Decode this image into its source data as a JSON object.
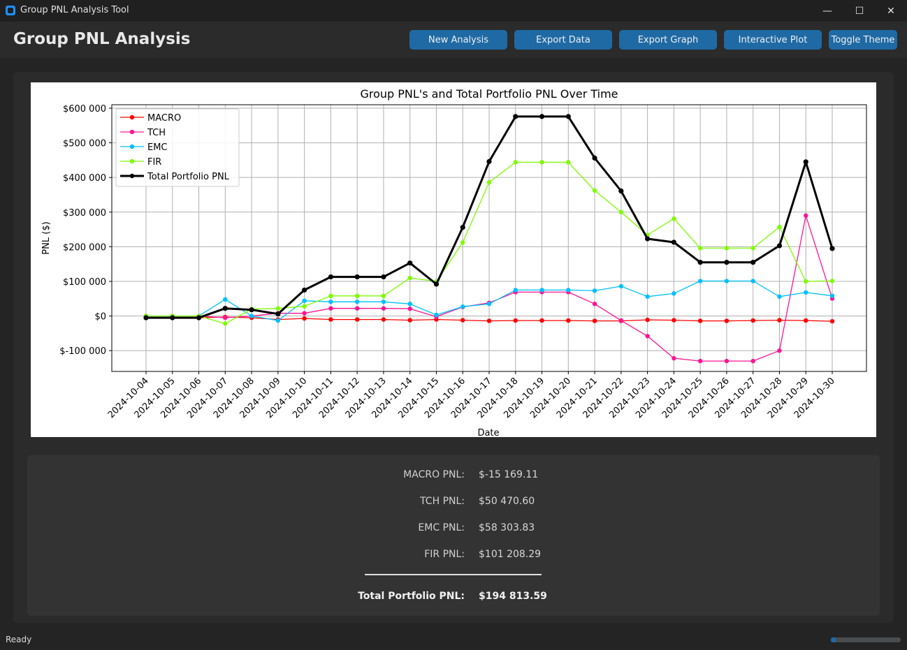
{
  "window": {
    "title": "Group PNL Analysis Tool",
    "minimize": "—",
    "maximize": "☐",
    "close": "✕"
  },
  "header": {
    "title": "Group PNL Analysis"
  },
  "toolbar": {
    "new_analysis": "New Analysis",
    "export_data": "Export Data",
    "export_graph": "Export Graph",
    "interactive_plot": "Interactive Plot",
    "toggle_theme": "Toggle Theme"
  },
  "summary": {
    "rows": [
      {
        "label": "MACRO PNL:",
        "value": "$-15 169.11"
      },
      {
        "label": "TCH PNL:",
        "value": "$50 470.60"
      },
      {
        "label": "EMC PNL:",
        "value": "$58 303.83"
      },
      {
        "label": "FIR PNL:",
        "value": "$101 208.29"
      }
    ],
    "total_label": "Total Portfolio PNL:",
    "total_value": "$194 813.59"
  },
  "status": {
    "text": "Ready",
    "progress": 0.07
  },
  "colors": {
    "accent": "#1f6aa5",
    "macro": "#ff0000",
    "tch": "#ff1493",
    "emc": "#00bfff",
    "fir": "#7cfc00",
    "total": "#000000"
  },
  "chart_data": {
    "type": "line",
    "title": "Group PNL's and Total Portfolio PNL Over Time",
    "xlabel": "Date",
    "ylabel": "PNL ($)",
    "ylim": [
      -160000,
      610000
    ],
    "yticks": [
      -100000,
      0,
      100000,
      200000,
      300000,
      400000,
      500000,
      600000
    ],
    "ytick_labels": [
      "$-100 000",
      "$0",
      "$100 000",
      "$200 000",
      "$300 000",
      "$400 000",
      "$500 000",
      "$600 000"
    ],
    "grid": true,
    "legend": "top-left",
    "x": [
      "2024-10-04",
      "2024-10-05",
      "2024-10-06",
      "2024-10-07",
      "2024-10-08",
      "2024-10-09",
      "2024-10-10",
      "2024-10-11",
      "2024-10-12",
      "2024-10-13",
      "2024-10-14",
      "2024-10-15",
      "2024-10-16",
      "2024-10-17",
      "2024-10-18",
      "2024-10-19",
      "2024-10-20",
      "2024-10-21",
      "2024-10-22",
      "2024-10-23",
      "2024-10-24",
      "2024-10-25",
      "2024-10-26",
      "2024-10-27",
      "2024-10-28",
      "2024-10-29",
      "2024-10-30"
    ],
    "series": [
      {
        "name": "MACRO",
        "color": "#ff0000",
        "width": 1.3,
        "values": [
          -5000,
          -5000,
          -5000,
          -3000,
          -5000,
          -10000,
          -7000,
          -10000,
          -10000,
          -10000,
          -12000,
          -10000,
          -12000,
          -14000,
          -13000,
          -13000,
          -13000,
          -14000,
          -14000,
          -11000,
          -12000,
          -14000,
          -14000,
          -13000,
          -12000,
          -13000,
          -15169
        ]
      },
      {
        "name": "TCH",
        "color": "#ff1493",
        "width": 1.3,
        "values": [
          0,
          0,
          0,
          -5000,
          0,
          8000,
          8000,
          22000,
          22000,
          22000,
          21000,
          -2000,
          26000,
          38000,
          69000,
          69000,
          69000,
          35000,
          -13000,
          -58000,
          -122000,
          -130000,
          -130000,
          -130000,
          -100000,
          290000,
          50471
        ]
      },
      {
        "name": "EMC",
        "color": "#00bfff",
        "width": 1.3,
        "values": [
          0,
          0,
          0,
          48000,
          0,
          -13000,
          44000,
          41000,
          41000,
          41000,
          35000,
          3000,
          27000,
          35000,
          75000,
          75000,
          75000,
          73000,
          86000,
          56000,
          65000,
          101000,
          101000,
          101000,
          56000,
          68000,
          58304
        ]
      },
      {
        "name": "FIR",
        "color": "#7cfc00",
        "width": 1.3,
        "values": [
          0,
          0,
          0,
          -22000,
          20000,
          22000,
          28000,
          58000,
          58000,
          58000,
          110000,
          100000,
          212000,
          386000,
          444000,
          444000,
          444000,
          362000,
          300000,
          234000,
          281000,
          196000,
          196000,
          196000,
          257000,
          100000,
          101208
        ]
      },
      {
        "name": "Total Portfolio PNL",
        "color": "#000000",
        "width": 3,
        "values": [
          -5000,
          -5000,
          -5000,
          22000,
          18000,
          6000,
          75000,
          113000,
          113000,
          113000,
          153000,
          92000,
          256000,
          446000,
          576000,
          576000,
          576000,
          456000,
          361000,
          223000,
          213000,
          155000,
          155000,
          155000,
          203000,
          445000,
          194814
        ]
      }
    ]
  }
}
